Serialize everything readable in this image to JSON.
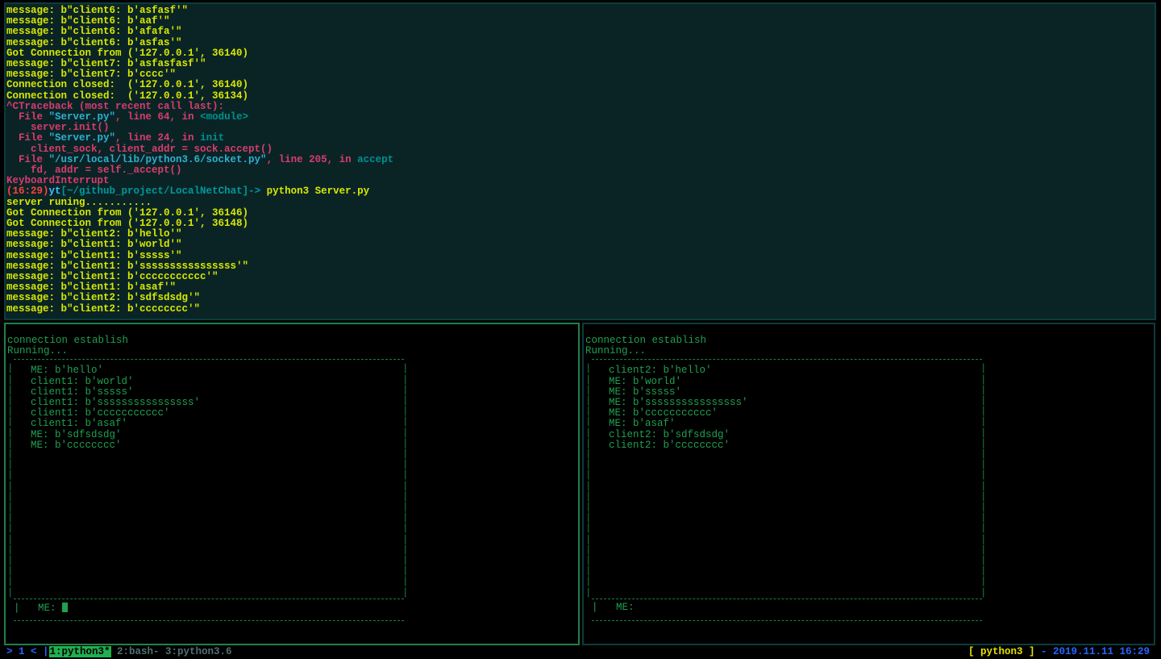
{
  "server_pane": {
    "lines_before_traceback": [
      "message: b\"client6: b'asfasf'\"",
      "message: b\"client6: b'aaf'\"",
      "message: b\"client6: b'afafa'\"",
      "message: b\"client6: b'asfas'\"",
      "Got Connection from ('127.0.0.1', 36140)",
      "message: b\"client7: b'asfasfasf'\"",
      "message: b\"client7: b'cccc'\"",
      "Connection closed:  ('127.0.0.1', 36140)",
      "Connection closed:  ('127.0.0.1', 36134)"
    ],
    "traceback": {
      "head": "^CTraceback (most recent call last):",
      "frame1_a": "  File ",
      "frame1_b": "\"Server.py\"",
      "frame1_c": ", line 64, in ",
      "frame1_d": "<module>",
      "frame1_call": "    server.init()",
      "frame2_a": "  File ",
      "frame2_b": "\"Server.py\"",
      "frame2_c": ", line 24, in ",
      "frame2_d": "init",
      "frame2_call": "    client_sock, client_addr = sock.accept()",
      "frame3_a": "  File ",
      "frame3_b": "\"/usr/local/lib/python3.6/socket.py\"",
      "frame3_c": ", line 205, in ",
      "frame3_d": "accept",
      "frame3_call": "    fd, addr = self._accept()",
      "tail": "KeyboardInterrupt"
    },
    "prompt": {
      "time": "(16:29)",
      "user": "yt",
      "path": "[~/github_project/LocalNetChat]",
      "arrow": "-> ",
      "cmd": "python3 Server.py"
    },
    "lines_after_prompt": [
      "server runing...........",
      "Got Connection from ('127.0.0.1', 36146)",
      "Got Connection from ('127.0.0.1', 36148)",
      "message: b\"client2: b'hello'\"",
      "message: b\"client1: b'world'\"",
      "message: b\"client1: b'sssss'\"",
      "message: b\"client1: b'ssssssssssssssss'\"",
      "message: b\"client1: b'ccccccccccc'\"",
      "message: b\"client1: b'asaf'\"",
      "message: b\"client2: b'sdfsdsdg'\"",
      "message: b\"client2: b'cccccccc'\""
    ]
  },
  "client_left": {
    "header1": "connection establish",
    "header2": "Running...",
    "messages": [
      "  ME: b'hello'",
      "  client1: b'world'",
      "  client1: b'sssss'",
      "  client1: b'ssssssssssssssss'",
      "  client1: b'ccccccccccc'",
      "  client1: b'asaf'",
      "  ME: b'sdfsdsdg'",
      "  ME: b'cccccccc'"
    ],
    "input_label": "   ME: "
  },
  "client_right": {
    "header1": "connection establish",
    "header2": "Running...",
    "messages": [
      "  client2: b'hello'",
      "  ME: b'world'",
      "  ME: b'sssss'",
      "  ME: b'ssssssssssssssss'",
      "  ME: b'ccccccccccc'",
      "  ME: b'asaf'",
      "  client2: b'sdfsdsdg'",
      "  client2: b'cccccccc'"
    ],
    "input_label": "   ME: "
  },
  "statusbar": {
    "left_prefix": "> 1 <  |",
    "win1": "1:python3*",
    "win2": " 2:bash-",
    "win3": " 3:python3.6",
    "mode": "[ python3 ]",
    "dash": " - ",
    "datetime": "2019.11.11 16:29"
  },
  "pipe_col": "|\n|\n|\n|\n|\n|\n|\n|\n|\n|\n|\n|\n|\n|\n|\n|\n|\n|\n|\n|\n|\n|"
}
